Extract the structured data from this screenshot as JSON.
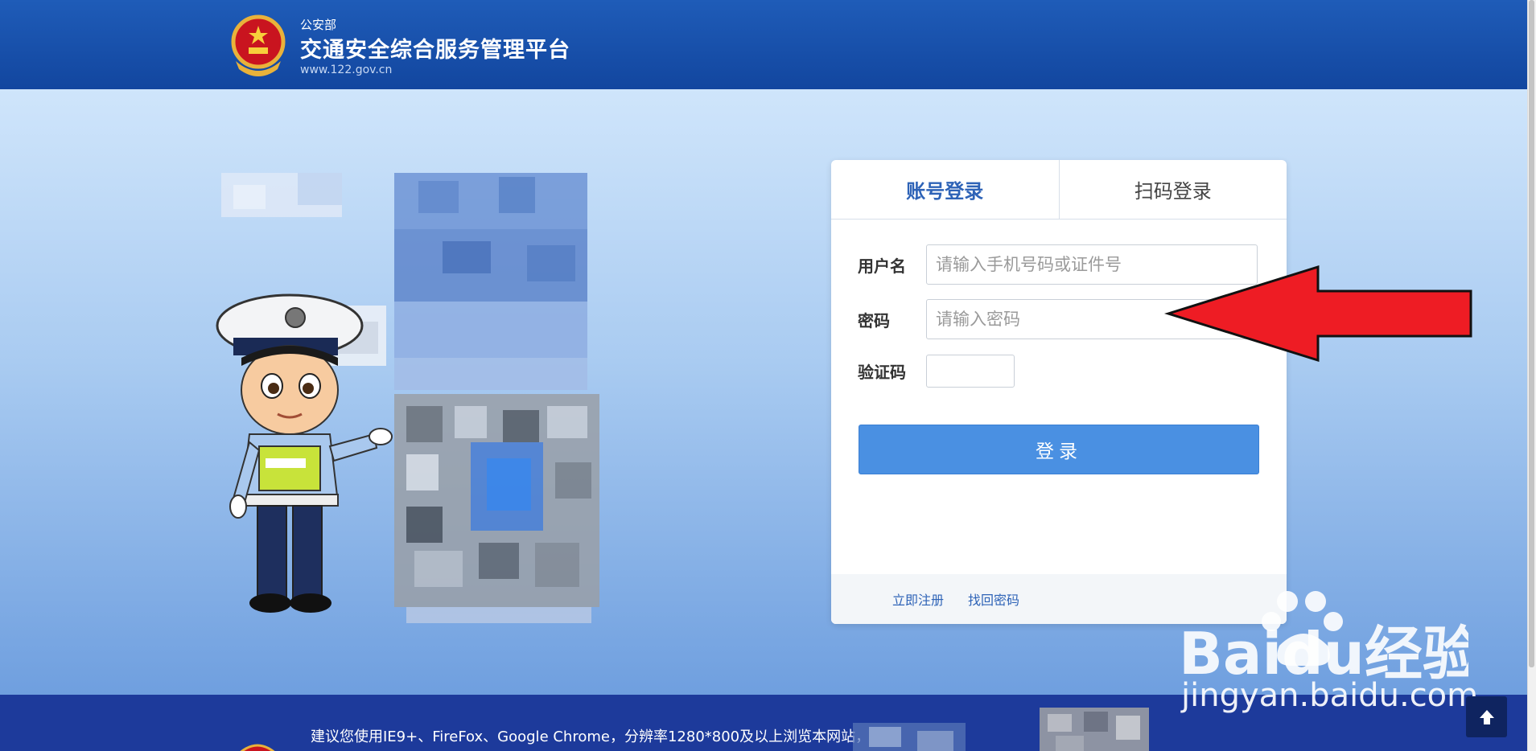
{
  "header": {
    "dept": "公安部",
    "title": "交通安全综合服务管理平台",
    "url": "www.122.gov.cn"
  },
  "login": {
    "tabs": [
      {
        "label": "账号登录",
        "active": true
      },
      {
        "label": "扫码登录",
        "active": false
      }
    ],
    "username_label": "用户名",
    "username_placeholder": "请输入手机号码或证件号",
    "password_label": "密码",
    "password_placeholder": "请输入密码",
    "captcha_label": "验证码",
    "submit_label": "登录",
    "register_link": "立即注册",
    "recover_link": "找回密码"
  },
  "footer": {
    "note": "建议您使用IE9+、FireFox、Google Chrome，分辨率1280*800及以上浏览本网站，获"
  },
  "watermark": {
    "brand": "Baidu经验",
    "url": "jingyan.baidu.com"
  },
  "colors": {
    "header": "#1f5cb8",
    "accent": "#4a90e2",
    "tab_active": "#2e63b7",
    "arrow": "#ee1c24",
    "footer": "#1d3a9b"
  }
}
